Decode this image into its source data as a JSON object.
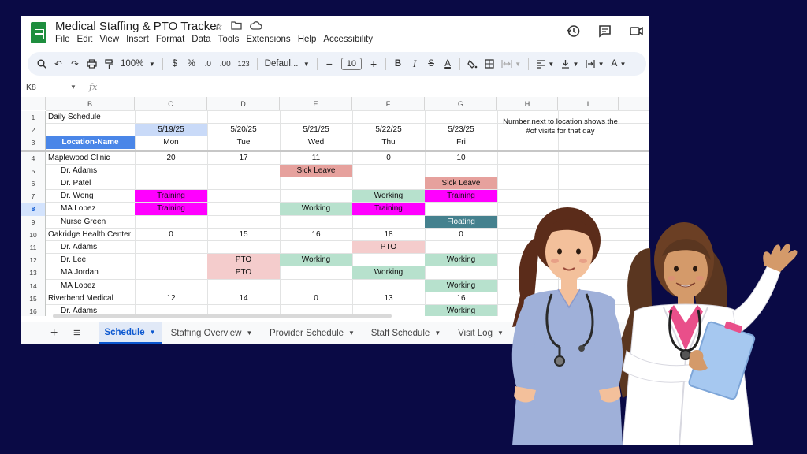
{
  "app": {
    "title": "Medical Staffing & PTO Tracker",
    "menu": [
      "File",
      "Edit",
      "View",
      "Insert",
      "Format",
      "Data",
      "Tools",
      "Extensions",
      "Help",
      "Accessibility"
    ]
  },
  "toolbar": {
    "zoom": "100%",
    "currency": "$",
    "percent": "%",
    "dec_decrease": ".0",
    "dec_increase": ".00",
    "number_format": "123",
    "font": "Defaul...",
    "font_size": "10",
    "minus": "−",
    "plus": "+",
    "bold": "B",
    "italic": "I",
    "strike": "S",
    "text_color": "A",
    "text_color2": "A"
  },
  "formula_bar": {
    "name_box": "K8",
    "fx": "fx"
  },
  "grid": {
    "columns": [
      "",
      "B",
      "C",
      "D",
      "E",
      "F",
      "G",
      "H",
      "I"
    ],
    "row_numbers": [
      "1",
      "2",
      "3",
      "4",
      "5",
      "6",
      "7",
      "8",
      "9",
      "10",
      "11",
      "12",
      "13",
      "14",
      "15",
      "16"
    ],
    "selected_row": "8",
    "title": "Daily Schedule",
    "location_header": "Location-Name",
    "dates": [
      "5/19/25",
      "5/20/25",
      "5/21/25",
      "5/22/25",
      "5/23/25"
    ],
    "weekdays": [
      "Mon",
      "Tue",
      "Wed",
      "Thu",
      "Fri"
    ],
    "note": "Number next to location shows the #of visits for that day",
    "rows": [
      {
        "name": "Maplewood Clinic",
        "type": "location",
        "cells": [
          "20",
          "17",
          "11",
          "0",
          "10"
        ]
      },
      {
        "name": "Dr. Adams",
        "type": "staff",
        "cells": [
          "",
          "",
          "Sick Leave",
          "",
          ""
        ]
      },
      {
        "name": "Dr. Patel",
        "type": "staff",
        "cells": [
          "",
          "",
          "",
          "",
          "Sick Leave"
        ]
      },
      {
        "name": "Dr. Wong",
        "type": "staff",
        "cells": [
          "Training",
          "",
          "",
          "Working",
          "Training"
        ]
      },
      {
        "name": "MA Lopez",
        "type": "staff",
        "cells": [
          "Training",
          "",
          "Working",
          "Training",
          ""
        ]
      },
      {
        "name": "Nurse Green",
        "type": "staff",
        "cells": [
          "",
          "",
          "",
          "",
          "Floating"
        ]
      },
      {
        "name": "Oakridge Health Center",
        "type": "location",
        "cells": [
          "0",
          "15",
          "16",
          "18",
          "0"
        ]
      },
      {
        "name": "Dr. Adams",
        "type": "staff",
        "cells": [
          "",
          "",
          "",
          "PTO",
          ""
        ]
      },
      {
        "name": "Dr. Lee",
        "type": "staff",
        "cells": [
          "",
          "PTO",
          "Working",
          "",
          "Working"
        ]
      },
      {
        "name": "MA Jordan",
        "type": "staff",
        "cells": [
          "",
          "PTO",
          "",
          "Working",
          ""
        ]
      },
      {
        "name": "MA Lopez",
        "type": "staff",
        "cells": [
          "",
          "",
          "",
          "",
          "Working"
        ]
      },
      {
        "name": "Riverbend Medical",
        "type": "location",
        "cells": [
          "12",
          "14",
          "0",
          "13",
          "16"
        ]
      },
      {
        "name": "Dr. Adams",
        "type": "staff",
        "cells": [
          "",
          "",
          "",
          "",
          "Working"
        ]
      }
    ]
  },
  "status_colors": {
    "Sick Leave": "#e6a19d",
    "Training": "#ff00ff",
    "Working": "#b7e1cd",
    "Floating": "#45818e",
    "PTO": "#f4cccc",
    "selected_date": "#c9daf8",
    "location_header": "#4a86e8"
  },
  "tabs": [
    {
      "label": "Schedule",
      "active": true
    },
    {
      "label": "Staffing Overview",
      "active": false
    },
    {
      "label": "Provider Schedule",
      "active": false
    },
    {
      "label": "Staff Schedule",
      "active": false
    },
    {
      "label": "Visit Log",
      "active": false
    }
  ],
  "tabbar": {
    "add": "+",
    "list": "≡"
  }
}
